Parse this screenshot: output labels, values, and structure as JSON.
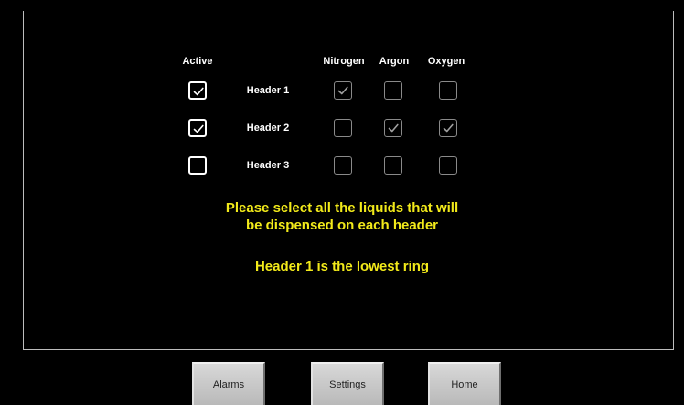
{
  "columns": {
    "active": "Active",
    "nitrogen": "Nitrogen",
    "argon": "Argon",
    "oxygen": "Oxygen"
  },
  "rows": [
    {
      "label": "Header 1",
      "active": true,
      "nitrogen": true,
      "argon": false,
      "oxygen": false
    },
    {
      "label": "Header 2",
      "active": true,
      "nitrogen": false,
      "argon": true,
      "oxygen": true
    },
    {
      "label": "Header 3",
      "active": false,
      "nitrogen": false,
      "argon": false,
      "oxygen": false
    }
  ],
  "messages": {
    "line1": "Please select all the liquids that will",
    "line2": "be dispensed on each header",
    "line3": "Header 1 is the lowest ring"
  },
  "nav": {
    "alarms": "Alarms",
    "settings": "Settings",
    "home": "Home"
  },
  "colors": {
    "background": "#000000",
    "message": "#f2ea1a",
    "text": "#ffffff"
  }
}
